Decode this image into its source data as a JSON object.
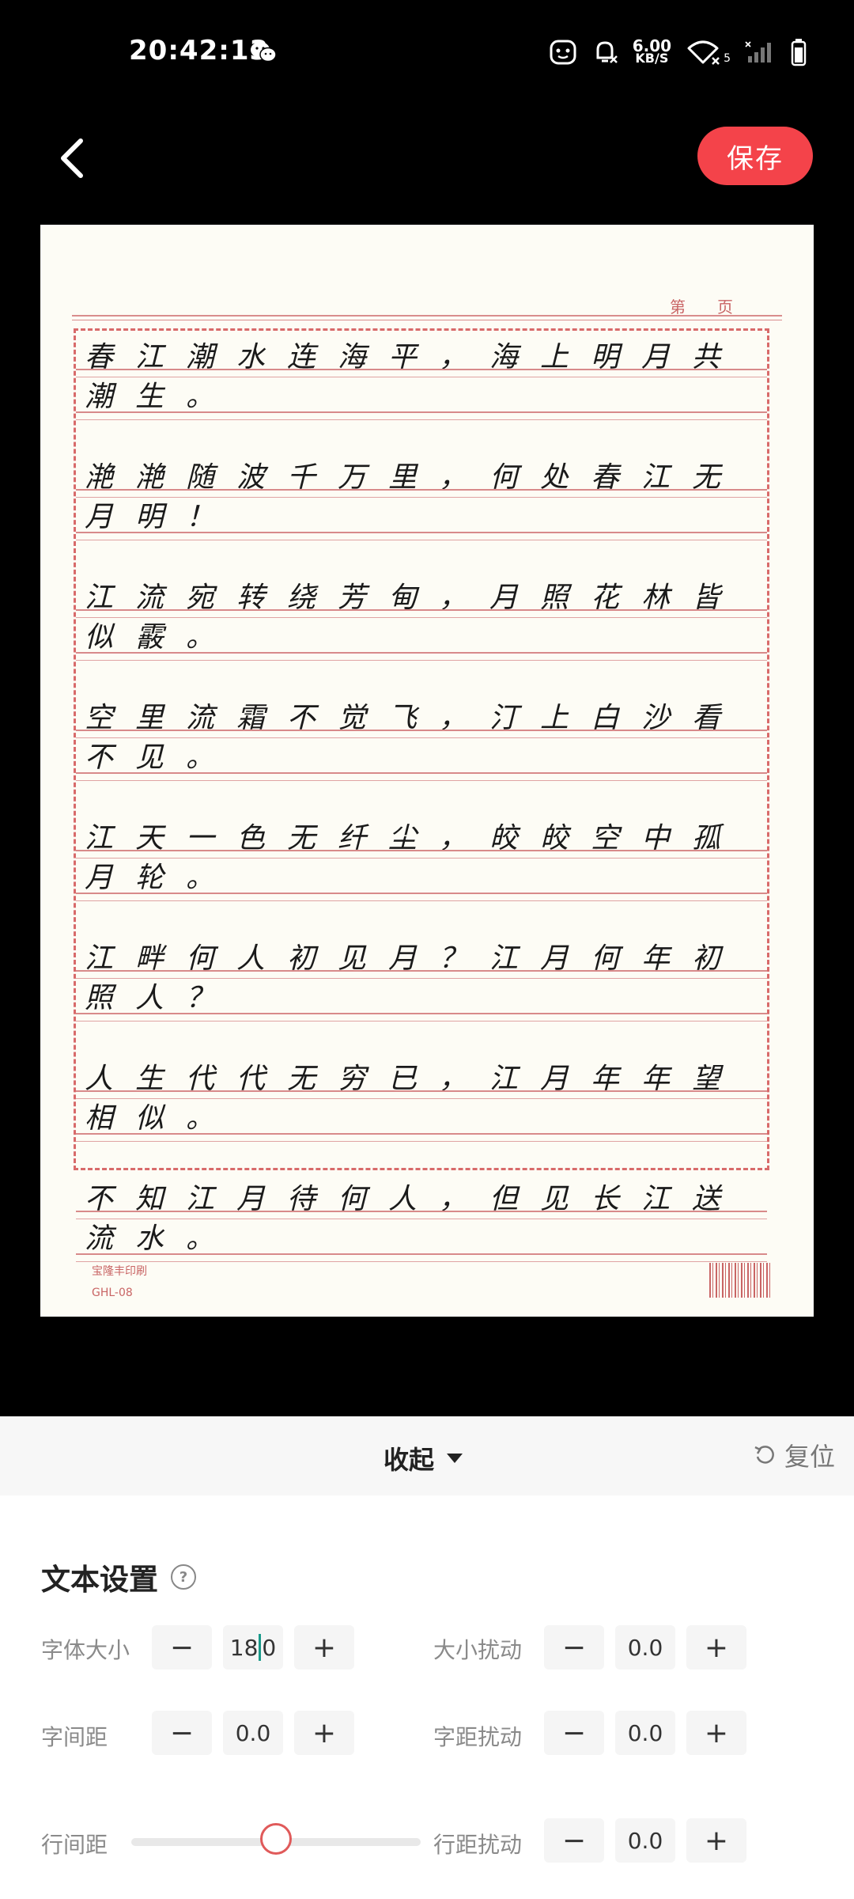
{
  "status_bar": {
    "time": "20:42:13",
    "speed_value": "6.00",
    "speed_unit": "KB/S",
    "sim_label": "5"
  },
  "header": {
    "save_label": "保存"
  },
  "preview": {
    "page_label": "第页",
    "lines": [
      "春江潮水连海平，海上明月共",
      "潮生。",
      "滟滟随波千万里，何处春江无",
      "月明！",
      "江流宛转绕芳甸，月照花林皆",
      "似霰。",
      "空里流霜不觉飞，汀上白沙看",
      "不见。",
      "江天一色无纤尘，皎皎空中孤",
      "月轮。",
      "江畔何人初见月？江月何年初",
      "照人？",
      "人生代代无穷已，江月年年望",
      "相似。",
      "不知江月待何人，但见长江送",
      "流水。"
    ],
    "footer_brand": "宝隆丰印刷",
    "footer_code": "GHL-08"
  },
  "panel": {
    "collapse_label": "收起",
    "reset_label": "复位",
    "section_title": "文本设置",
    "help_symbol": "?",
    "minus": "−",
    "plus": "+",
    "font_size": {
      "label": "字体大小",
      "value_a": "18",
      "value_b": "0"
    },
    "size_jitter": {
      "label": "大小扰动",
      "value": "0.0"
    },
    "char_spacing": {
      "label": "字间距",
      "value": "0.0"
    },
    "spacing_jitter": {
      "label": "字距扰动",
      "value": "0.0"
    },
    "line_spacing": {
      "label": "行间距",
      "slider_fraction": 0.5
    },
    "line_jitter": {
      "label": "行距扰动",
      "value": "0.0"
    }
  },
  "colors": {
    "accent": "#f4434a",
    "caret": "#1a9a8a",
    "paper_rule": "#d88a8a"
  }
}
